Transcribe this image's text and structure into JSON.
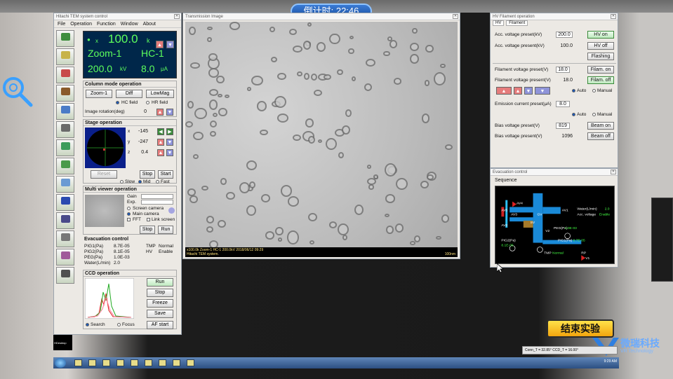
{
  "timer": "倒计时: 22:46",
  "control_window": {
    "title": "Hitachi TEM system control",
    "menu": [
      "File",
      "Operation",
      "Function",
      "Window",
      "About"
    ],
    "tools": [
      {
        "icon": "screen-icon",
        "label": "",
        "color": "#3e8e3e"
      },
      {
        "icon": "microscope-icon",
        "label": "",
        "color": "#c7b349"
      },
      {
        "icon": "filament-icon",
        "label": "",
        "color": "#c84a4a"
      },
      {
        "icon": "lens-icon",
        "label": "",
        "color": "#8a5a2a"
      },
      {
        "icon": "aperture-icon",
        "label": "",
        "color": "#4a7bc7"
      },
      {
        "icon": "stage-icon",
        "label": "",
        "color": "#6a6a6a"
      },
      {
        "icon": "focus-icon",
        "label": "",
        "color": "#3c9c5c"
      },
      {
        "icon": "brightness-icon",
        "label": "",
        "color": "#4a9a4a"
      },
      {
        "icon": "wobbler-icon",
        "label": "",
        "color": "#6b9ad3"
      },
      {
        "icon": "pen-icon",
        "label": "",
        "color": "#2a4ab0"
      },
      {
        "icon": "pda-icon",
        "label": "",
        "color": "#4a4a8a"
      },
      {
        "icon": "camera-icon",
        "label": "",
        "color": "#777"
      },
      {
        "icon": "gauge-icon",
        "label": "",
        "color": "#a05a9a"
      },
      {
        "icon": "lock-icon",
        "label": "",
        "color": "#505050"
      }
    ],
    "display": {
      "bullet": "●",
      "unit_x": "x",
      "mag_value": "100.0",
      "mag_unit": "k",
      "mode": "Zoom-1",
      "lens": "HC-1",
      "voltage": "200.0",
      "voltage_unit": "kV",
      "current": "8.0",
      "current_unit": "μA"
    },
    "column_mode": {
      "title": "Column mode operation",
      "buttons": [
        "Zoom-1",
        "Diff",
        "LowMag"
      ],
      "radio_hc": "HC field",
      "radio_hr": "HR field",
      "rotation_label": "Image rotation(deg)",
      "rotation_value": "0"
    },
    "stage": {
      "title": "Stage operation",
      "x_label": "x",
      "x_value": "-145",
      "y_label": "y",
      "y_value": "-247",
      "z_label": "z",
      "z_value": "0.4",
      "reset": "Reset",
      "stop": "Stop",
      "start": "Start",
      "radio_slow": "Slow",
      "radio_mid": "Mid",
      "radio_fast": "Fast"
    },
    "multi_viewer": {
      "title": "Multi viewer operation",
      "gain": "Gain",
      "exp": "Exp.",
      "screen_camera": "Screen camera",
      "main_camera": "Main camera",
      "fft": "FFT",
      "link_screen": "Link screen",
      "stop": "Stop",
      "run": "Run"
    },
    "evac_control": {
      "title": "Evacuation control",
      "rows": [
        {
          "label": "PIG1(Pa)",
          "value": "8.7E-05",
          "label2": "TMP",
          "value2": "Normal"
        },
        {
          "label": "PIG2(Pa)",
          "value": "8.1E-05",
          "label2": "HV",
          "value2": "Enable"
        },
        {
          "label": "PEG(Pa)",
          "value": "1.0E-03",
          "label2": "",
          "value2": ""
        },
        {
          "label": "Water(L/min)",
          "value": "2.0",
          "label2": "",
          "value2": ""
        }
      ]
    },
    "ccd": {
      "title": "CCD operation",
      "run": "Run",
      "stop": "Stop",
      "freeze": "Freeze",
      "save": "Save",
      "radio_search": "Search",
      "radio_focus": "Focus",
      "af_start": "AF start"
    }
  },
  "image_window": {
    "title": "Transmission Image",
    "info_line1": "x100.0k Zoom-1 HC-1 200.0kV 2018/06/12 09:29",
    "info_line2": "Hitachi TEM system.",
    "scale": "100nm"
  },
  "hv_window": {
    "title": "HV Filament operation",
    "tabs": [
      "HV",
      "Filament"
    ],
    "acc_preset_label": "Acc. voltage preset(kV)",
    "acc_preset_value": "200.0",
    "acc_present_label": "Acc. voltage present(kV)",
    "acc_present_value": "100.0",
    "hv_on": "HV on",
    "hv_off": "HV off",
    "flashing": "Flashing",
    "fil_preset_label": "Filament voltage preset(V)",
    "fil_preset_value": "18.0",
    "fil_present_label": "Filament voltage present(V)",
    "fil_present_value": "18.0",
    "filam_on": "Filam. on",
    "filam_off": "Filam. off",
    "auto": "Auto",
    "manual": "Manual",
    "emission_label": "Emission current preset(μA)",
    "emission_value": "8.0",
    "bias_preset_label": "Bias voltage preset(V)",
    "bias_preset_value": "819",
    "bias_present_label": "Bias voltage present(V)",
    "bias_present_value": "1096",
    "beam_on": "Beam on",
    "beam_off": "Beam off"
  },
  "evac_window": {
    "title": "Evacuation control",
    "sequence": "Sequence",
    "labels": {
      "av4": "AV4",
      "av5": "AV5",
      "av3": "AV3",
      "av2": "AV2",
      "av1": "AV1",
      "gv": "GV",
      "v2": "V2",
      "v1": "V1",
      "sv": "SV",
      "water": "Water(L/min)",
      "water_val": "2.0",
      "acc": "Acc. voltage",
      "acc_val": "Enable",
      "peg": "PEG(Pa)",
      "peg_val": "1.0E-03",
      "pig1": "PIG1(Pa)",
      "pig1_val": "8.7E-05",
      "pig2": "PIG2(Pa)",
      "pig2_val": "8.1E-05",
      "tmp": "TMP",
      "tmp_val": "Normal",
      "rp": "RP"
    }
  },
  "end_button": "结束实验",
  "logo": {
    "cn": "微瑞科技",
    "en": "VR Technology"
  },
  "taskbar": {
    "tray": "9:29 AM"
  },
  "coord_bar": "Conn_T = 32.85° CCD_T = 16.00°",
  "console": "HDesktop"
}
